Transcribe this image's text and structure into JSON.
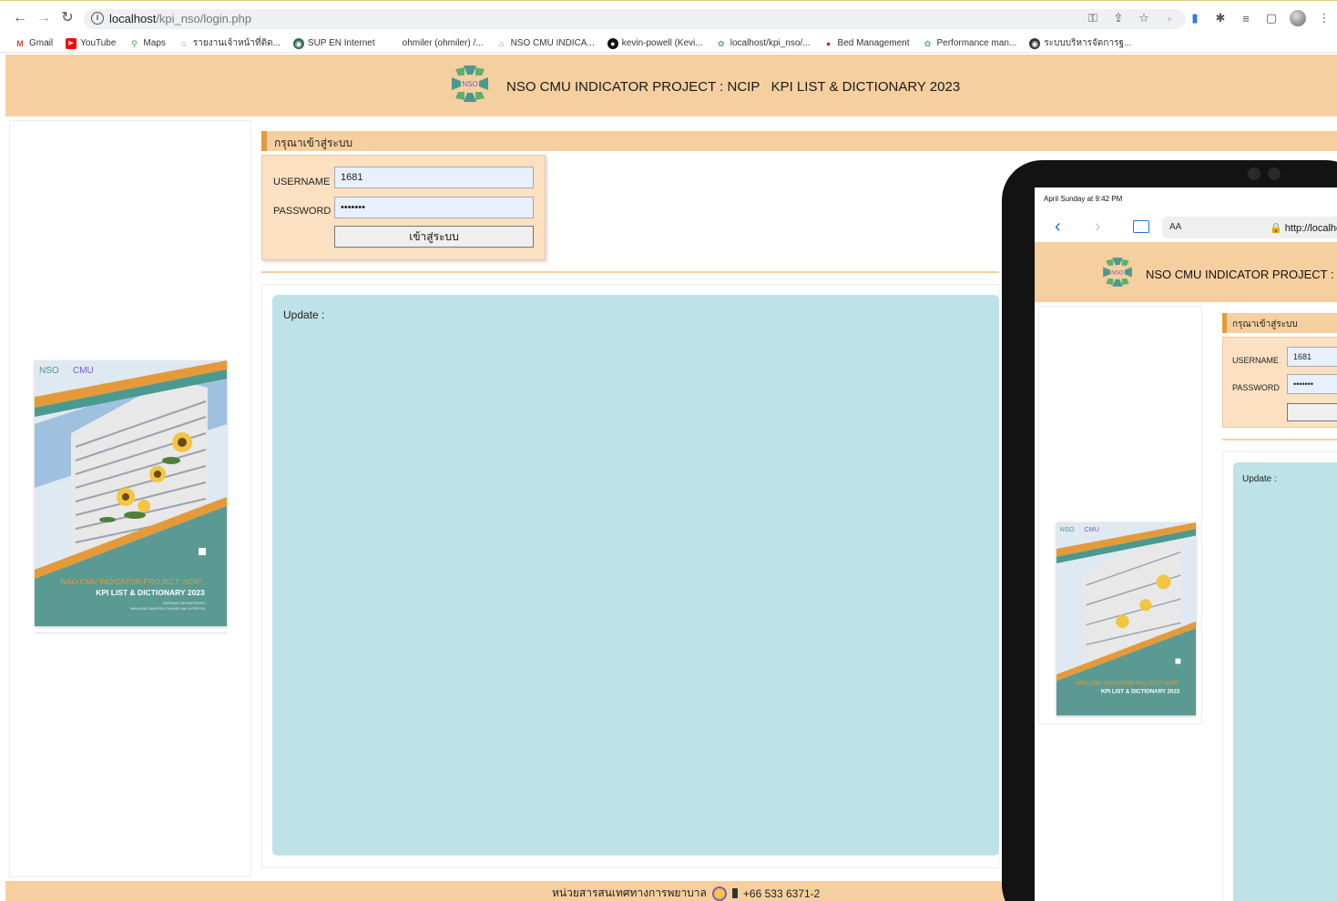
{
  "browser": {
    "url_host": "localhost",
    "url_path": "/kpi_nso/login.php",
    "bookmarks": [
      {
        "label": "Gmail",
        "color": "#db4437",
        "glyph": "M"
      },
      {
        "label": "YouTube",
        "color": "#ff0000",
        "glyph": "▶"
      },
      {
        "label": "Maps",
        "color": "#34a853",
        "glyph": "⚲"
      },
      {
        "label": "รายงานเจ้าหน้าที่ติด...",
        "color": "#f2b01e",
        "glyph": "⌂"
      },
      {
        "label": "SUP EN Internet",
        "color": "#0f9d58",
        "glyph": "◉"
      },
      {
        "label": "ohmiler (ohmiler) /...",
        "color": "#ffffff",
        "glyph": ""
      },
      {
        "label": "NSO CMU INDICA...",
        "color": "#4aa3a2",
        "glyph": "⌂"
      },
      {
        "label": "kevin-powell (Kevi...",
        "color": "#111111",
        "glyph": "●"
      },
      {
        "label": "localhost/kpi_nso/...",
        "color": "#5aa39a",
        "glyph": "✿"
      },
      {
        "label": "Bed Management",
        "color": "#c0392b",
        "glyph": "●"
      },
      {
        "label": "Performance man...",
        "color": "#5aa39a",
        "glyph": "✿"
      },
      {
        "label": "ระบบบริหารจัดการฐ...",
        "color": "#333333",
        "glyph": "◉"
      }
    ]
  },
  "page": {
    "title": "NSO CMU INDICATOR PROJECT : NCIP   KPI LIST & DICTIONARY 2023",
    "login_heading": "กรุณาเข้าสู่ระบบ",
    "username_label": "USERNAME",
    "username_value": "1681",
    "password_label": "PASSWORD",
    "password_value": "•••••••",
    "login_button": "เข้าสู่ระบบ",
    "update_label": "Update :",
    "footer_text": "หน่วยสารสนเทศทางการพยาบาล",
    "footer_phone": "+66 533 6371-2"
  },
  "poster": {
    "brand": "NSO",
    "brand2": "CMU",
    "line1": "NSO CMU INDICATOR PROJECT:  NCIP",
    "line2": "KPI LIST & DICTIONARY 2023",
    "line3": "NURSING DEPARTMENT,",
    "line4": "MAHARAJ NAKORN CHIANG MAI HOSPITAL"
  },
  "tablet": {
    "status_time": "April Sunday at 9:42 PM",
    "aa": "AA",
    "url": "http://localhost",
    "title": "NSO CMU INDICATOR PROJECT : NCIP",
    "login_heading": "กรุณาเข้าสู่ระบบ",
    "username_label": "USERNAME",
    "username_value": "1681",
    "password_label": "PASSWORD",
    "password_value": "•••••••",
    "update_label": "Update :"
  },
  "colors": {
    "header": "#f6cfa0",
    "accent": "#e59a3a",
    "update_bg": "#bde2e8",
    "teal": "#4a9a8f"
  }
}
